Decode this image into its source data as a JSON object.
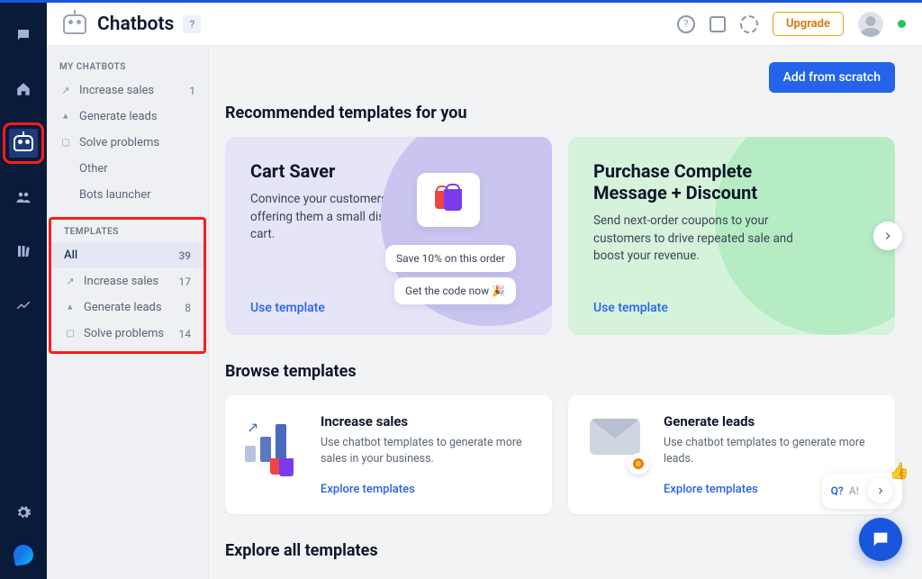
{
  "header": {
    "title": "Chatbots",
    "help_glyph": "?",
    "upgrade": "Upgrade"
  },
  "sidebar": {
    "my_label": "MY CHATBOTS",
    "my_items": [
      {
        "label": "Increase sales",
        "count": "1"
      },
      {
        "label": "Generate leads",
        "count": ""
      },
      {
        "label": "Solve problems",
        "count": ""
      },
      {
        "label": "Other",
        "count": ""
      },
      {
        "label": "Bots launcher",
        "count": ""
      }
    ],
    "templates_label": "TEMPLATES",
    "template_items": [
      {
        "label": "All",
        "count": "39"
      },
      {
        "label": "Increase sales",
        "count": "17"
      },
      {
        "label": "Generate leads",
        "count": "8"
      },
      {
        "label": "Solve problems",
        "count": "14"
      }
    ]
  },
  "main": {
    "add_scratch": "Add from scratch",
    "recommended_title": "Recommended templates for you",
    "card1": {
      "title": "Cart Saver",
      "desc": "Convince your customers to buy, by offering them a small discount in the cart.",
      "bubble1": "Save 10% on this order",
      "bubble2": "Get the code now 🎉",
      "cta": "Use template"
    },
    "card2": {
      "title": "Purchase Complete Message + Discount",
      "desc": "Send next-order coupons to your customers to drive repeated sale and boost your revenue.",
      "cta": "Use template"
    },
    "browse_title": "Browse templates",
    "browse1": {
      "title": "Increase sales",
      "desc": "Use chatbot templates to generate more sales in your business.",
      "cta": "Explore templates"
    },
    "browse2": {
      "title": "Generate leads",
      "desc": "Use chatbot templates to generate more leads.",
      "cta": "Explore templates"
    },
    "explore_title": "Explore all templates"
  },
  "faq": {
    "q": "Q?",
    "a": "A!"
  }
}
